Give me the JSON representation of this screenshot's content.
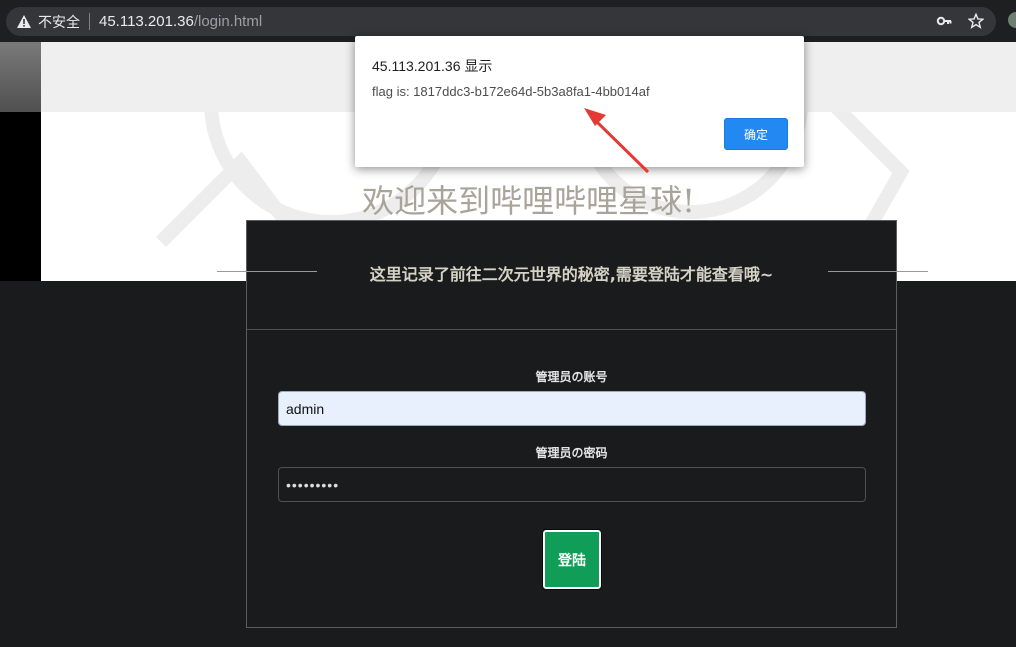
{
  "browser": {
    "security_label": "不安全",
    "url_host": "45.113.201.36",
    "url_path": "/login.html",
    "icons": [
      "warning-triangle-icon",
      "key-icon",
      "star-icon"
    ]
  },
  "page": {
    "welcome": "欢迎来到哔哩哔哩星球!",
    "panel_title": "这里记录了前往二次元世界的秘密,需要登陆才能查看哦~",
    "username_label": "管理员の账号",
    "username_value": "admin",
    "password_label": "管理员の密码",
    "password_value": "•••••••••",
    "login_button": "登陆",
    "colors": {
      "login_button": "#0f9d58",
      "panel_bg": "#191b1c",
      "welcome_text": "#a9a49a"
    }
  },
  "alert": {
    "title": "45.113.201.36 显示",
    "message": "flag is: 1817ddc3-b172e64d-5b3a8fa1-4bb014af",
    "ok_button": "确定",
    "ok_color": "#2389f2"
  },
  "annotation": {
    "arrow_color": "#e53935"
  }
}
